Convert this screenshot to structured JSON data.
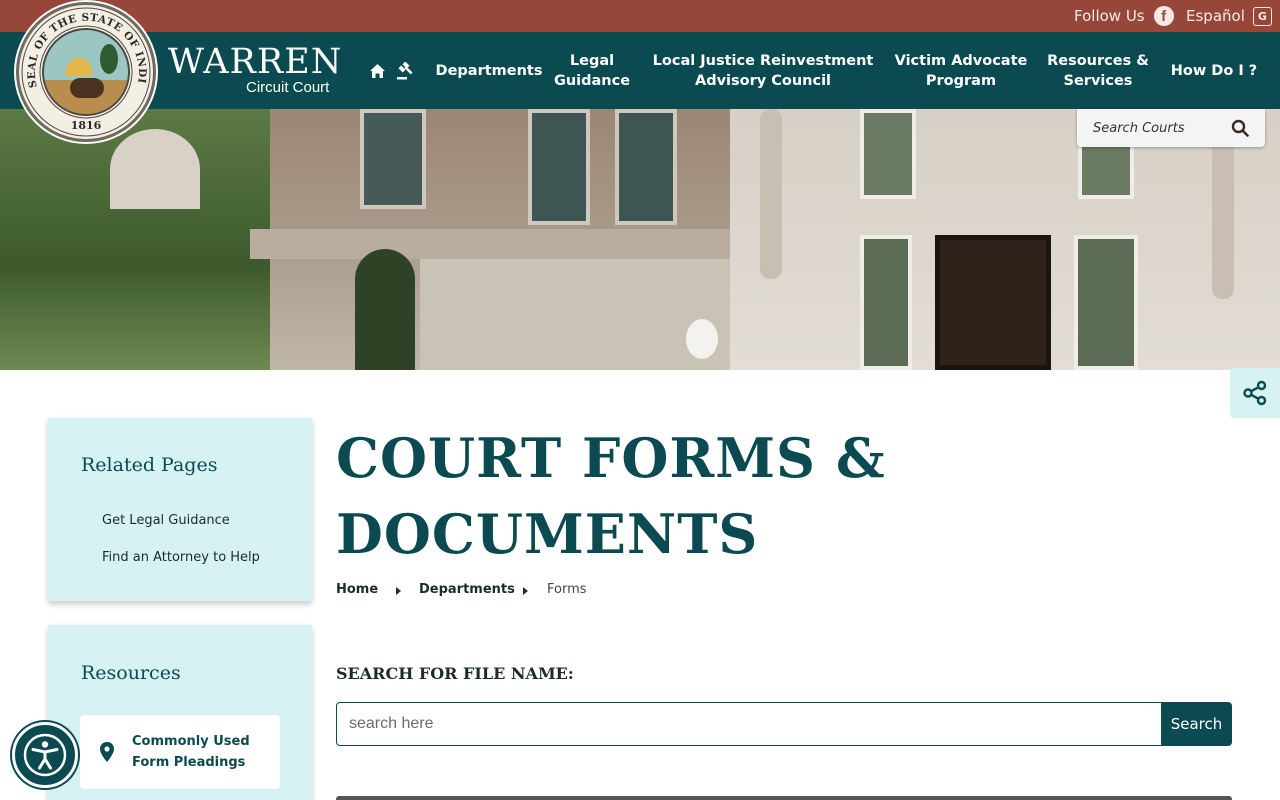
{
  "topbar": {
    "follow_label": "Follow Us",
    "facebook_icon": "facebook-icon",
    "espanol_label": "Español",
    "translate_icon": "translate-icon",
    "color": "#96473a"
  },
  "brand": {
    "name": "WARREN",
    "subtitle": "Circuit Court",
    "seal_year": "1816",
    "seal_text": "SEAL OF THE STATE OF INDIANA",
    "nav_color": "#0a4a50"
  },
  "nav": {
    "home_icon": "home-icon",
    "gavel_icon": "gavel-icon",
    "items": [
      {
        "label": "Departments"
      },
      {
        "label": "Legal Guidance"
      },
      {
        "label": "Local Justice Reinvestment Advisory Council"
      },
      {
        "label": "Victim Advocate Program"
      },
      {
        "label": "Resources & Services"
      },
      {
        "label": "How Do I ?"
      }
    ]
  },
  "search_courts": {
    "placeholder": "Search Courts"
  },
  "sidebar": {
    "related_title": "Related Pages",
    "related_links": [
      {
        "label": "Get Legal Guidance"
      },
      {
        "label": "Find an Attorney to Help"
      }
    ],
    "resources_title": "Resources",
    "resources": [
      {
        "label": "Commonly Used Form Pleadings"
      }
    ]
  },
  "main": {
    "title": "COURT FORMS & DOCUMENTS",
    "breadcrumb": [
      {
        "label": "Home"
      },
      {
        "label": "Departments"
      },
      {
        "label": "Forms"
      }
    ],
    "file_search_label": "SEARCH FOR FILE NAME:",
    "file_search_placeholder": "search here",
    "file_search_button": "Search"
  }
}
